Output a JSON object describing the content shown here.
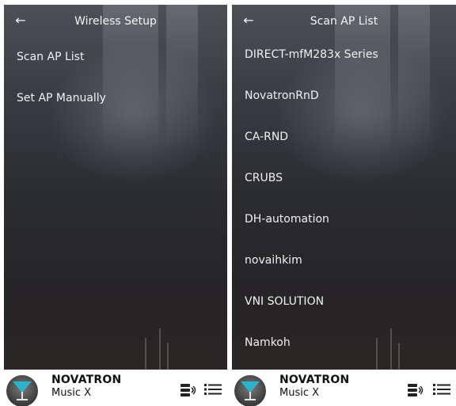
{
  "left_screen": {
    "appbar": {
      "back_icon": "arrow-left-icon",
      "title": "Wireless Setup"
    },
    "menu": [
      {
        "label": "Scan AP List"
      },
      {
        "label": "Set AP Manually"
      }
    ]
  },
  "right_screen": {
    "appbar": {
      "back_icon": "arrow-left-icon",
      "title": "Scan AP List"
    },
    "access_points": [
      {
        "ssid": "DIRECT-mfM283x Series"
      },
      {
        "ssid": "NovatronRnD"
      },
      {
        "ssid": "CA-RND"
      },
      {
        "ssid": "CRUBS"
      },
      {
        "ssid": "DH-automation"
      },
      {
        "ssid": "novaihkim"
      },
      {
        "ssid": "VNI SOLUTION"
      },
      {
        "ssid": "Namkoh"
      }
    ]
  },
  "player_bar": {
    "brand": "NOVATRON",
    "subtitle": "Music X",
    "logo_icon": "novatron-glass-logo",
    "device_icon": "speaker-stack-icon",
    "list_icon": "list-icon"
  },
  "colors": {
    "background_top": "#4d5157",
    "background_bottom": "#2b2625",
    "text_on_dark": "#f1f1f1",
    "player_bar_bg": "#ffffff",
    "player_icon": "#222222"
  }
}
